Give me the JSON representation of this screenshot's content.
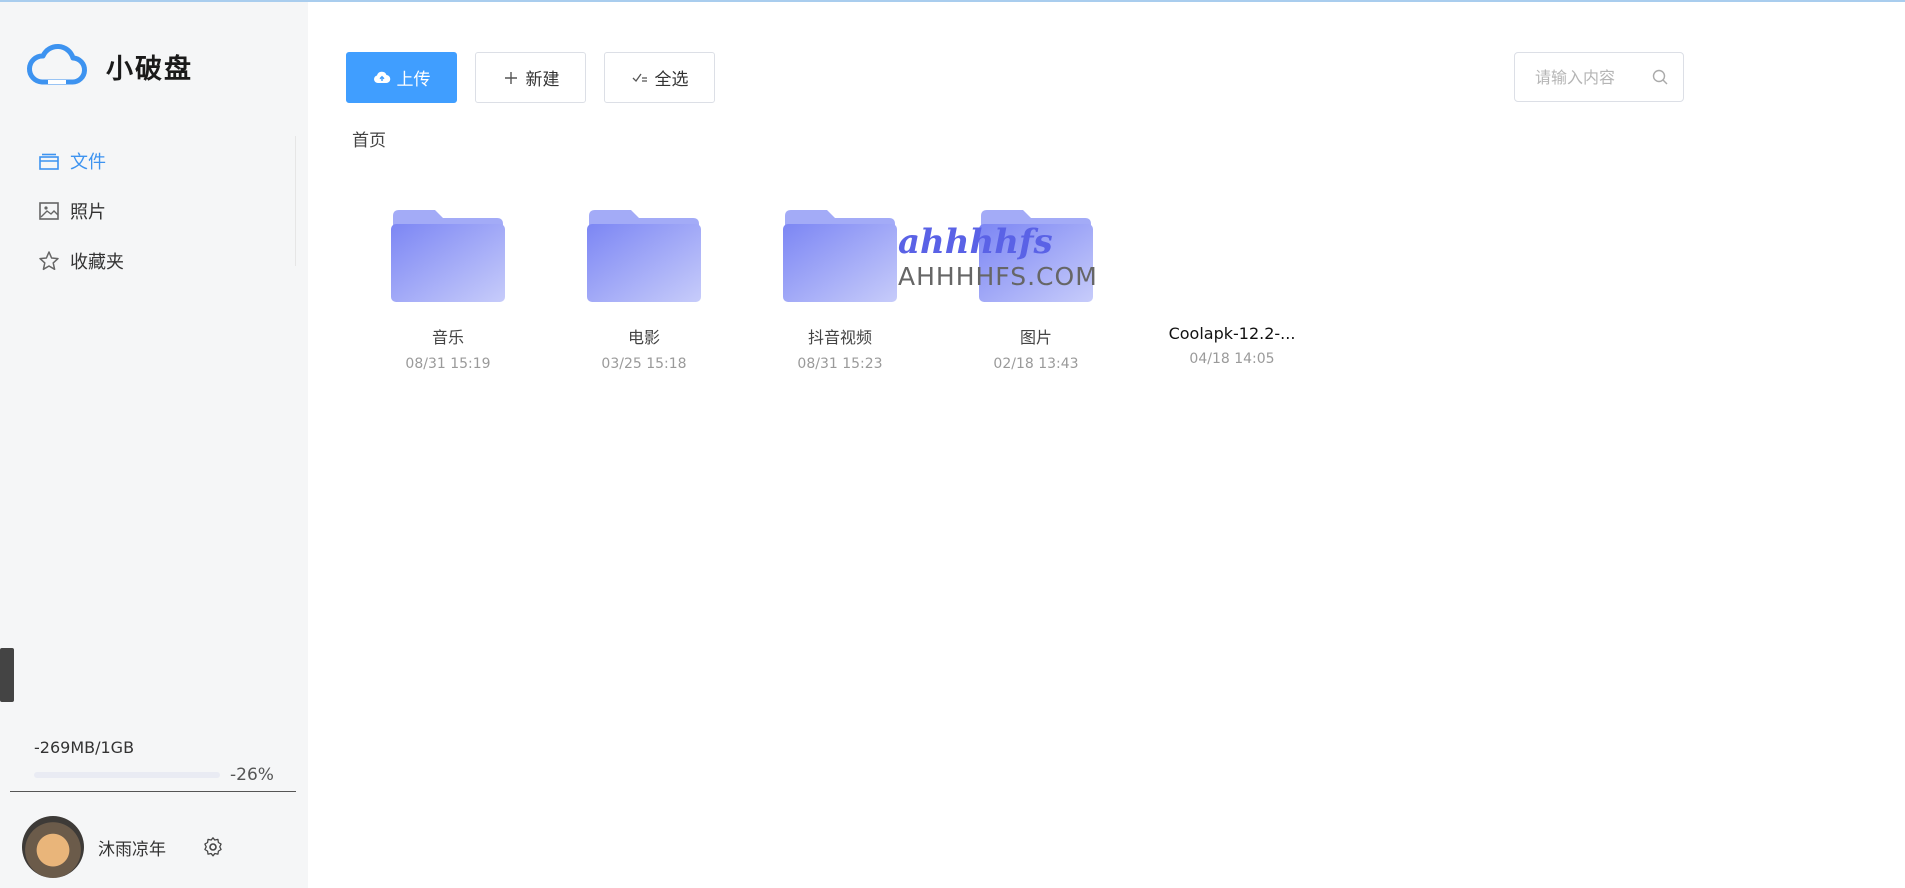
{
  "app": {
    "name": "小破盘"
  },
  "sidebar": {
    "items": [
      {
        "label": "文件",
        "icon": "files-icon",
        "active": true
      },
      {
        "label": "照片",
        "icon": "image-icon",
        "active": false
      },
      {
        "label": "收藏夹",
        "icon": "star-icon",
        "active": false
      }
    ],
    "storage": {
      "text": "-269MB/1GB",
      "percent": "-26%",
      "fill_fraction": 0
    },
    "user": {
      "name": "沐雨凉年"
    }
  },
  "toolbar": {
    "upload_label": "上传",
    "new_label": "新建",
    "select_all_label": "全选"
  },
  "search": {
    "placeholder": "请输入内容"
  },
  "breadcrumb": {
    "current": "首页"
  },
  "files": [
    {
      "name": "音乐",
      "date": "08/31 15:19",
      "type": "folder"
    },
    {
      "name": "电影",
      "date": "03/25 15:18",
      "type": "folder"
    },
    {
      "name": "抖音视频",
      "date": "08/31 15:23",
      "type": "folder"
    },
    {
      "name": "图片",
      "date": "02/18 13:43",
      "type": "folder"
    },
    {
      "name": "Coolapk-12.2-...",
      "date": "04/18 14:05",
      "type": "file"
    }
  ],
  "watermark": {
    "top": "ahhhhfs",
    "bottom": "AHHHHFS.COM"
  },
  "colors": {
    "accent": "#409eff",
    "active_nav": "#3d93f0",
    "folder": "#8b96f5"
  }
}
